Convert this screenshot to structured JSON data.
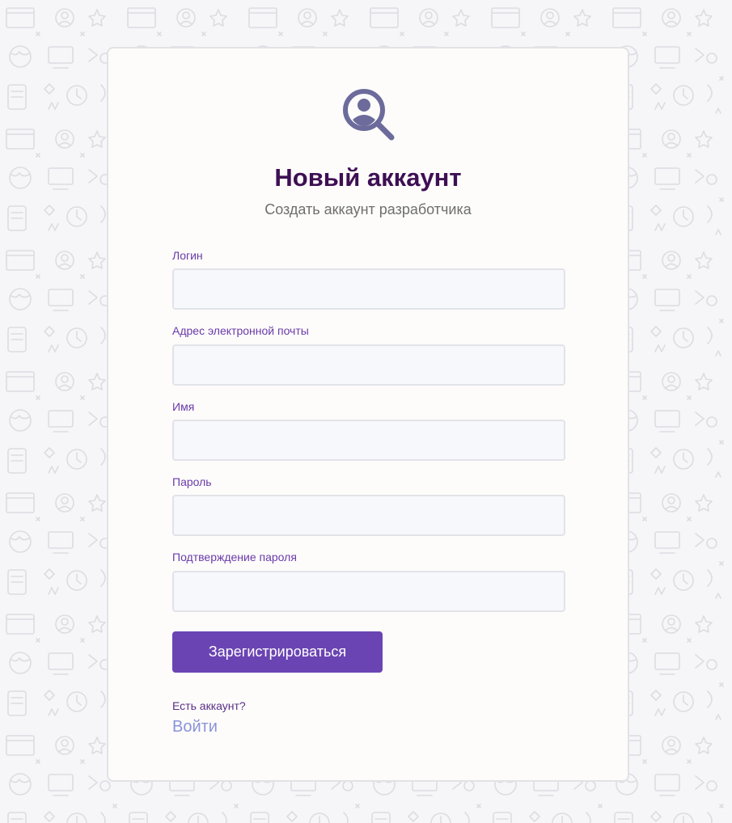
{
  "header": {
    "title": "Новый аккаунт",
    "subtitle": "Создать аккаунт разработчика"
  },
  "form": {
    "fields": [
      {
        "label": "Логин",
        "value": ""
      },
      {
        "label": "Адрес электронной почты",
        "value": ""
      },
      {
        "label": "Имя",
        "value": ""
      },
      {
        "label": "Пароль",
        "value": ""
      },
      {
        "label": "Подтверждение пароля",
        "value": ""
      }
    ],
    "submit_label": "Зарегистрироваться"
  },
  "footer": {
    "have_account": "Есть аккаунт?",
    "login_link": "Войти"
  },
  "icons": {
    "logo": "user-search-icon"
  },
  "colors": {
    "page_background": "#f6f6f8",
    "card_background": "#fdfcfb",
    "title": "#3e0f54",
    "label": "#6a3aa8",
    "button": "#6b44b3",
    "link": "#8a93d9",
    "logo": "#6c6b9b"
  }
}
